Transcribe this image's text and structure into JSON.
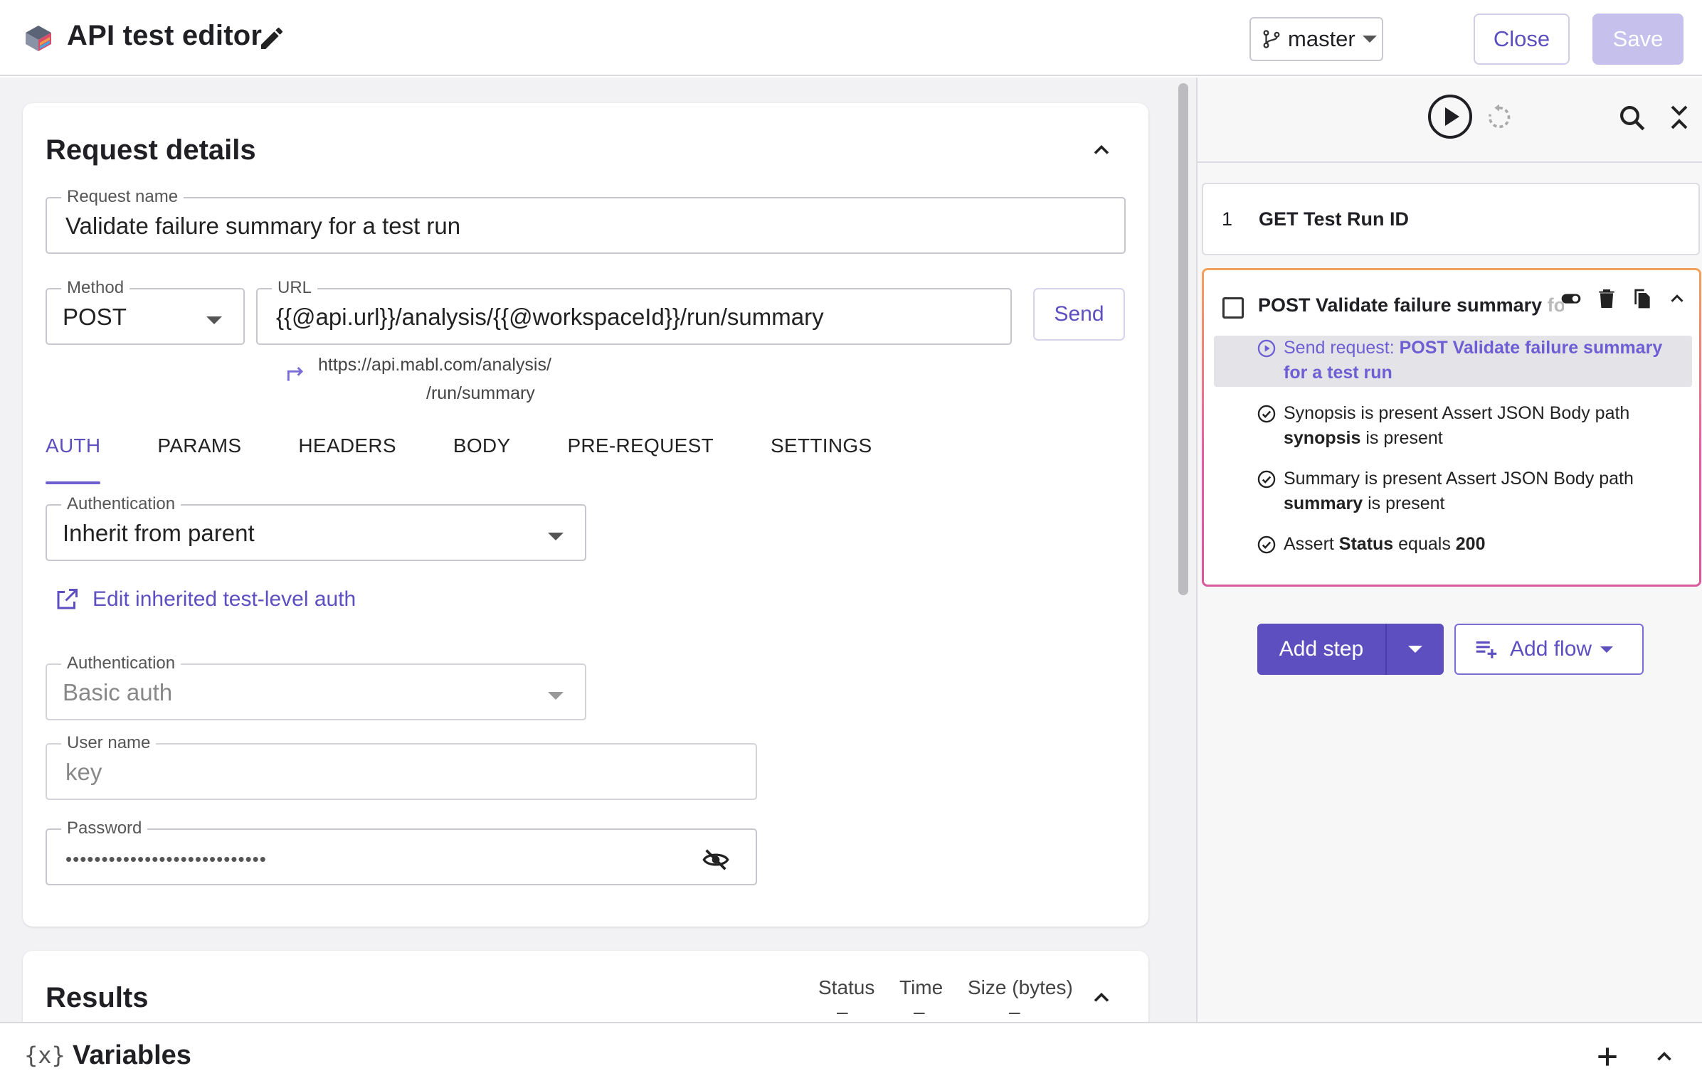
{
  "header": {
    "title": "API test editor",
    "branch": "master",
    "close_label": "Close",
    "save_label": "Save"
  },
  "request": {
    "section_title": "Request details",
    "name_label": "Request name",
    "name_value": "Validate failure summary for a test run",
    "method_label": "Method",
    "method_value": "POST",
    "url_label": "URL",
    "url_value": "{{@api.url}}/analysis/{{@workspaceId}}/run/summary",
    "send_label": "Send",
    "url_preview_line1": "https://api.mabl.com/analysis/",
    "url_preview_line2": "/run/summary",
    "tabs": [
      "AUTH",
      "PARAMS",
      "HEADERS",
      "BODY",
      "PRE-REQUEST",
      "SETTINGS"
    ],
    "active_tab": "AUTH",
    "auth_label": "Authentication",
    "auth_value": "Inherit from parent",
    "edit_link": "Edit inherited test-level auth",
    "inherited_auth_label": "Authentication",
    "inherited_auth_value": "Basic auth",
    "username_label": "User name",
    "username_value": "key",
    "password_label": "Password",
    "password_mask": "••••••••••••••••••••••••••••"
  },
  "results": {
    "title": "Results",
    "status_label": "Status",
    "time_label": "Time",
    "size_label": "Size (bytes)",
    "status_value": "–",
    "time_value": "–",
    "size_value": "–"
  },
  "steps": {
    "step1_num": "1",
    "step1_name": "GET Test Run ID",
    "step2_title": "POST Validate failure summary ",
    "step2_title_fade": "fo",
    "substeps": {
      "s1_prefix": "Send request: ",
      "s1_bold": "POST Validate failure summary for a test run",
      "s2_text": "Synopsis is present Assert JSON Body path ",
      "s2_bold": "synopsis",
      "s2_suffix": " is present",
      "s3_text": "Summary is present Assert JSON Body path ",
      "s3_bold": "summary",
      "s3_suffix": " is present",
      "s4_prefix": "Assert ",
      "s4_bold1": "Status",
      "s4_mid": " equals ",
      "s4_bold2": "200"
    },
    "add_step_label": "Add step",
    "add_flow_label": "Add flow"
  },
  "variables": {
    "icon_text": "{x}",
    "title": "Variables"
  },
  "colors": {
    "accent": "#5d4fc0",
    "save_disabled": "#c5c1ec",
    "step_border_gradient_start": "#f2a25a",
    "step_border_gradient_end": "#e85aa8"
  },
  "icons": {
    "logo": "mabl-logo-icon",
    "edit": "pencil-icon",
    "branch": "git-branch-icon",
    "run": "play-circle-icon",
    "rerun": "rerun-icon",
    "search": "search-icon",
    "collapse": "collapse-all-icon",
    "toggle": "toggle-icon",
    "delete": "trash-icon",
    "copy": "copy-icon",
    "eye": "eye-off-icon"
  }
}
